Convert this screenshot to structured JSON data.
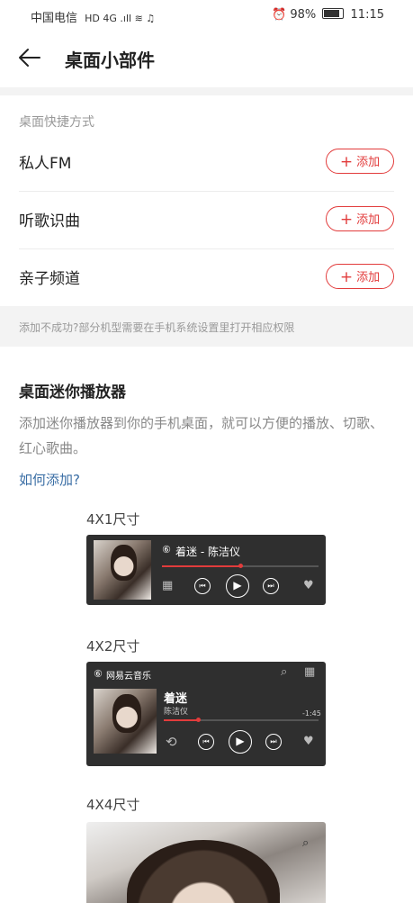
{
  "status_bar": {
    "carrier": "中国电信",
    "signal_text": "HD 4G .ıll ≋ ♫",
    "alarm": "⏰",
    "battery": "98%",
    "time": "11:15"
  },
  "header": {
    "back_icon": "arrow-left",
    "title": "桌面小部件"
  },
  "shortcuts": {
    "section_label": "桌面快捷方式",
    "add_label": "添加",
    "items": [
      {
        "name": "私人FM"
      },
      {
        "name": "听歌识曲"
      },
      {
        "name": "亲子频道"
      }
    ]
  },
  "notice": "添加不成功?部分机型需要在手机系统设置里打开相应权限",
  "mini_player": {
    "title": "桌面迷你播放器",
    "description": "添加迷你播放器到你的手机桌面，就可以方便的播放、切歌、红心歌曲。",
    "how_link": "如何添加?"
  },
  "widgets": {
    "w4x1": {
      "label": "4X1尺寸",
      "song_line": "着迷 - 陈洁仪",
      "progress": 0.5
    },
    "w4x2": {
      "label": "4X2尺寸",
      "brand": "网易云音乐",
      "song": "着迷",
      "artist": "陈洁仪",
      "time_remaining": "-1:45",
      "progress": 0.22
    },
    "w4x4": {
      "label": "4X4尺寸"
    }
  },
  "colors": {
    "accent": "#e23c3c",
    "link": "#3a6ea5",
    "widget_bg": "#2f2f2f"
  }
}
